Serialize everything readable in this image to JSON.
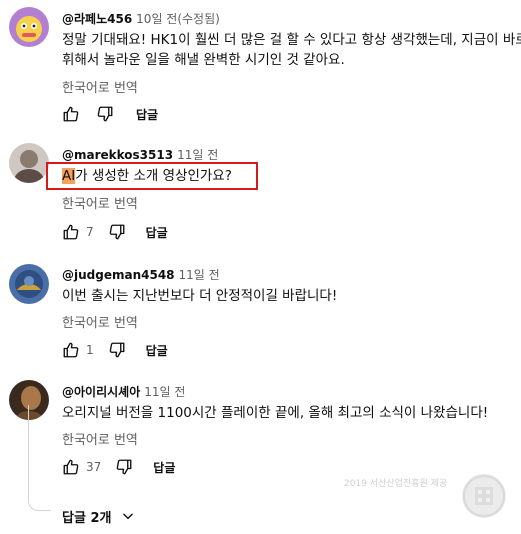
{
  "translate_label": "한국어로 번역",
  "reply_label": "답글",
  "comments": [
    {
      "author": "@라페노456",
      "time": "10일 전(수정됨)",
      "lines": [
        "정말 기대돼요! HK1이 훨씬 더 많은 걸 할 수 있다고 항상 생각했는데, 지금이 바로",
        "휘해서 놀라운 일을 해낼 완벽한 시기인 것 같아요."
      ],
      "likes": ""
    },
    {
      "author": "@marekkos3513",
      "time": "11일 전",
      "highlight": "AI",
      "text_rest": "가 생성한 소개 영상인가요?",
      "likes": "7"
    },
    {
      "author": "@judgeman4548",
      "time": "11일 전",
      "lines": [
        "이번 출시는 지난번보다 더 안정적이길 바랍니다!"
      ],
      "likes": "1"
    },
    {
      "author": "@아이리시셰아",
      "time": "11일 전",
      "lines": [
        "오리지널 버전을 1100시간 플레이한 끝에, 올해 최고의 소식이 나왔습니다!"
      ],
      "likes": "37"
    }
  ],
  "more_replies": "답글 2개",
  "watermark_text": "2019 서산산업진흥원 제공",
  "icons": [
    "like-icon",
    "dislike-icon",
    "chevron-down-icon"
  ]
}
